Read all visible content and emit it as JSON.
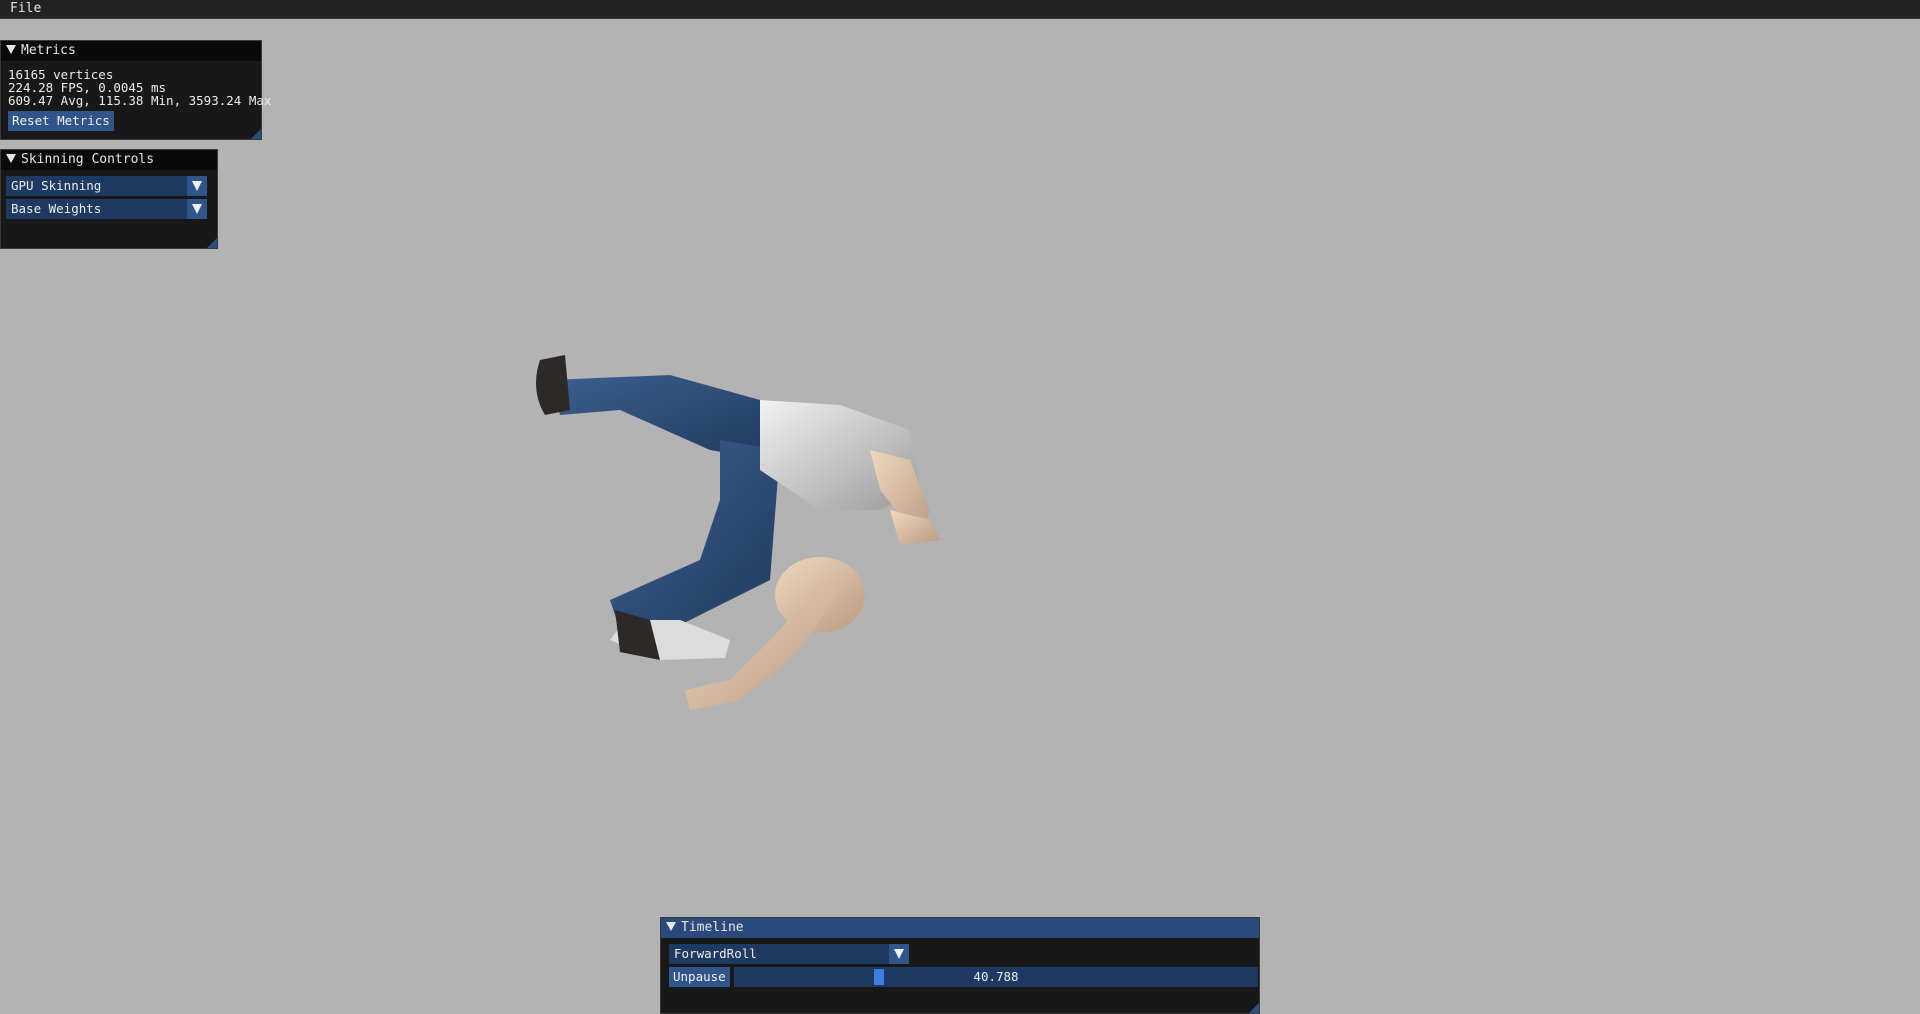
{
  "menubar": {
    "items": [
      "File"
    ]
  },
  "metrics": {
    "title": "Metrics",
    "vertices": "16165 vertices",
    "fps": "224.28 FPS, 0.0045 ms",
    "stats": "609.47 Avg, 115.38 Min, 3593.24 Max",
    "reset_label": "Reset Metrics"
  },
  "skinning": {
    "title": "Skinning Controls",
    "mode": "GPU Skinning",
    "weights": "Base Weights"
  },
  "timeline": {
    "title": "Timeline",
    "animation": "ForwardRoll",
    "pause_label": "Unpause",
    "time": "40.788",
    "progress": 0.27
  },
  "colors": {
    "background": "#b3b3b3",
    "accent": "#30558a",
    "slider_grab": "#3d7de0"
  }
}
